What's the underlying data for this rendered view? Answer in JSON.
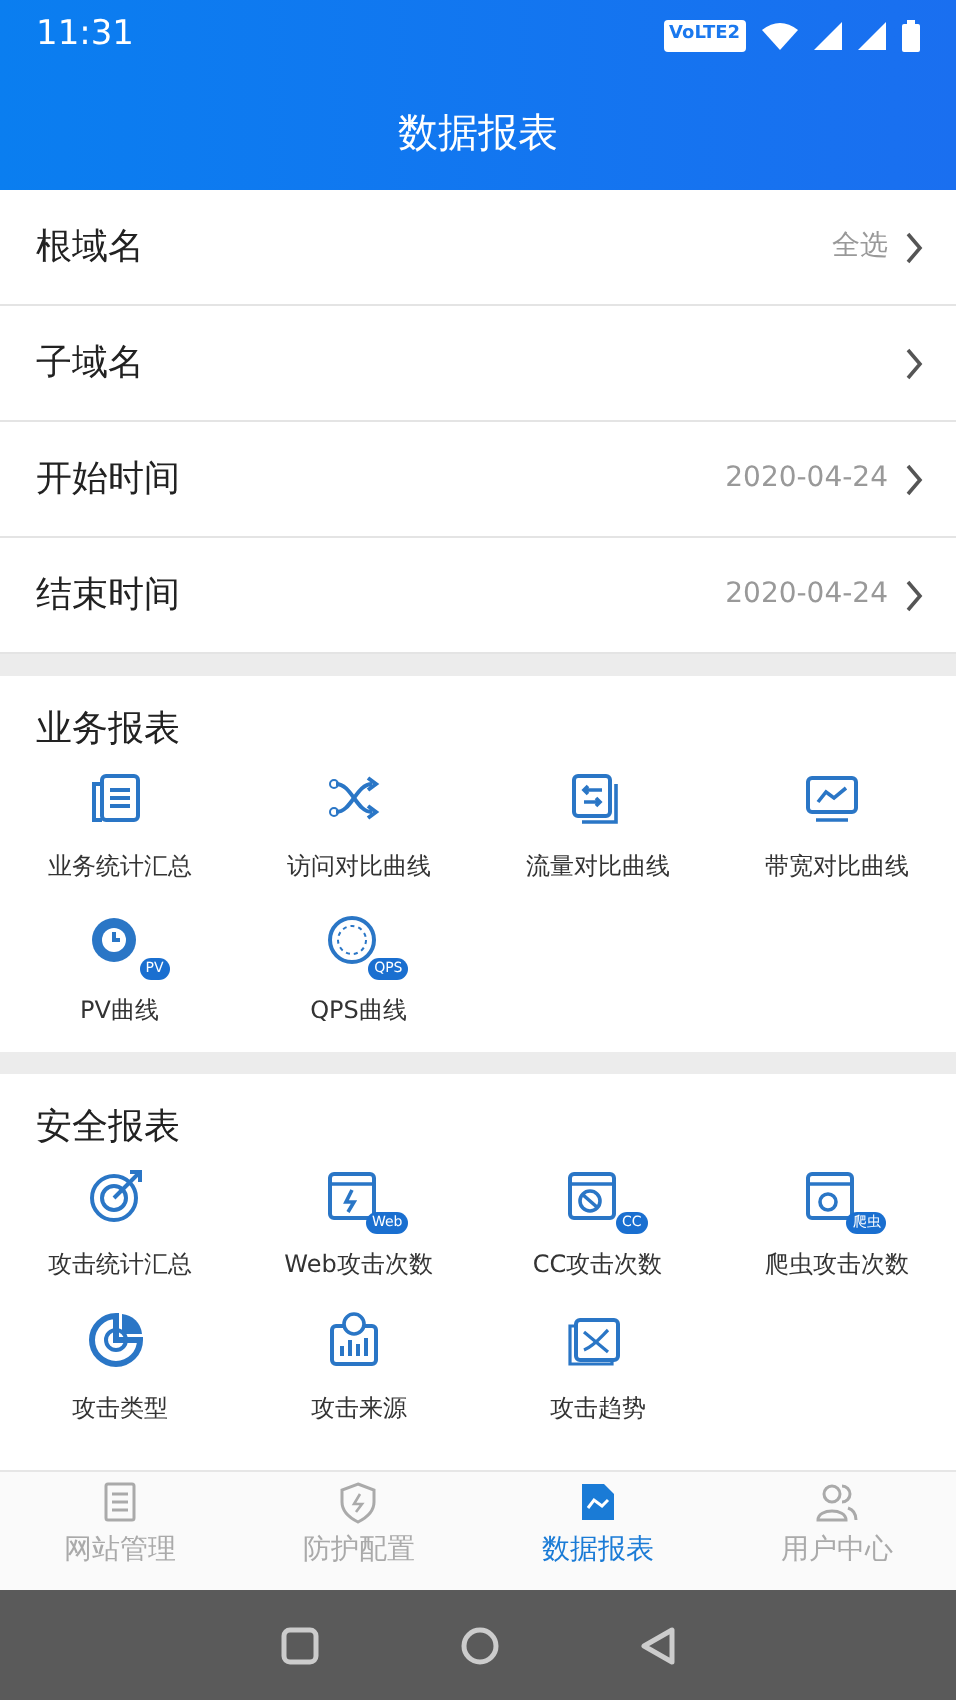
{
  "status_bar": {
    "time": "11:31",
    "network_label": "VoLTE2"
  },
  "header": {
    "title": "数据报表"
  },
  "filters": [
    {
      "label": "根域名",
      "value": "全选"
    },
    {
      "label": "子域名"
    },
    {
      "label": "开始时间",
      "value": "2020-04-24"
    },
    {
      "label": "结束时间",
      "value": "2020-04-24"
    }
  ],
  "sections": [
    {
      "title": "业务报表",
      "items": [
        {
          "label": "业务统计汇总"
        },
        {
          "label": "访问对比曲线"
        },
        {
          "label": "流量对比曲线"
        },
        {
          "label": "带宽对比曲线"
        },
        {
          "label": "PV曲线",
          "badge": "PV"
        },
        {
          "label": "QPS曲线",
          "badge": "QPS"
        }
      ]
    },
    {
      "title": "安全报表",
      "items": [
        {
          "label": "攻击统计汇总"
        },
        {
          "label": "Web攻击次数",
          "badge": "Web"
        },
        {
          "label": "CC攻击次数",
          "badge": "CC"
        },
        {
          "label": "爬虫攻击次数",
          "badge": "爬虫"
        },
        {
          "label": "攻击类型"
        },
        {
          "label": "攻击来源"
        },
        {
          "label": "攻击趋势"
        }
      ]
    }
  ],
  "tab_bar": [
    {
      "label": "网站管理",
      "selected": false
    },
    {
      "label": "防护配置",
      "selected": false
    },
    {
      "label": "数据报表",
      "selected": true
    },
    {
      "label": "用户中心",
      "selected": false
    }
  ]
}
